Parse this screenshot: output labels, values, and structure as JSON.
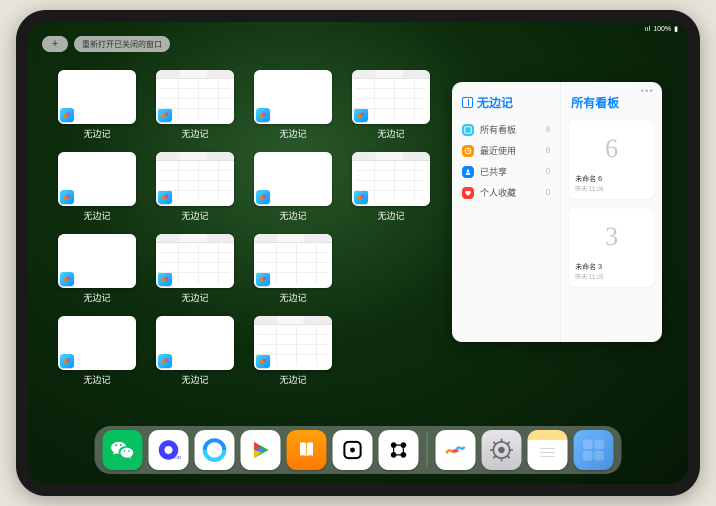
{
  "status": {
    "signal": "•••",
    "wifi": "⌇",
    "battery": "100%"
  },
  "topbar": {
    "plus": "+",
    "reopen_label": "重新打开已关闭的窗口"
  },
  "window_label": "无边记",
  "grid_layout": [
    4,
    4,
    3,
    3
  ],
  "variants": [
    "blank",
    "tabs",
    "blank",
    "tabs",
    "blank",
    "tabs",
    "blank",
    "tabs",
    "blank",
    "tabs",
    "tabs",
    "blank",
    "blank",
    "tabs"
  ],
  "side_panel": {
    "left_title": "无边记",
    "items": [
      {
        "label": "所有看板",
        "count": 8,
        "color": "blue"
      },
      {
        "label": "最近使用",
        "count": 8,
        "color": "orange"
      },
      {
        "label": "已共享",
        "count": 0,
        "color": "pblue"
      },
      {
        "label": "个人收藏",
        "count": 0,
        "color": "red"
      }
    ],
    "right_title": "所有看板",
    "boards": [
      {
        "name": "未命名 6",
        "sub": "昨天 11:26",
        "glyph": "6"
      },
      {
        "name": "未命名 3",
        "sub": "昨天 11:25",
        "glyph": "3"
      }
    ]
  },
  "dock": [
    {
      "id": "wechat",
      "name": "微信"
    },
    {
      "id": "quark",
      "name": "夸克"
    },
    {
      "id": "qbrowser",
      "name": "QQ浏览器"
    },
    {
      "id": "play",
      "name": "应用商店"
    },
    {
      "id": "books",
      "name": "图书"
    },
    {
      "id": "dice",
      "name": "游戏"
    },
    {
      "id": "connect",
      "name": "连接"
    },
    {
      "id": "sep"
    },
    {
      "id": "freeform",
      "name": "无边记"
    },
    {
      "id": "settings",
      "name": "设置"
    },
    {
      "id": "notes",
      "name": "备忘录"
    },
    {
      "id": "folder",
      "name": "App资源库"
    }
  ]
}
